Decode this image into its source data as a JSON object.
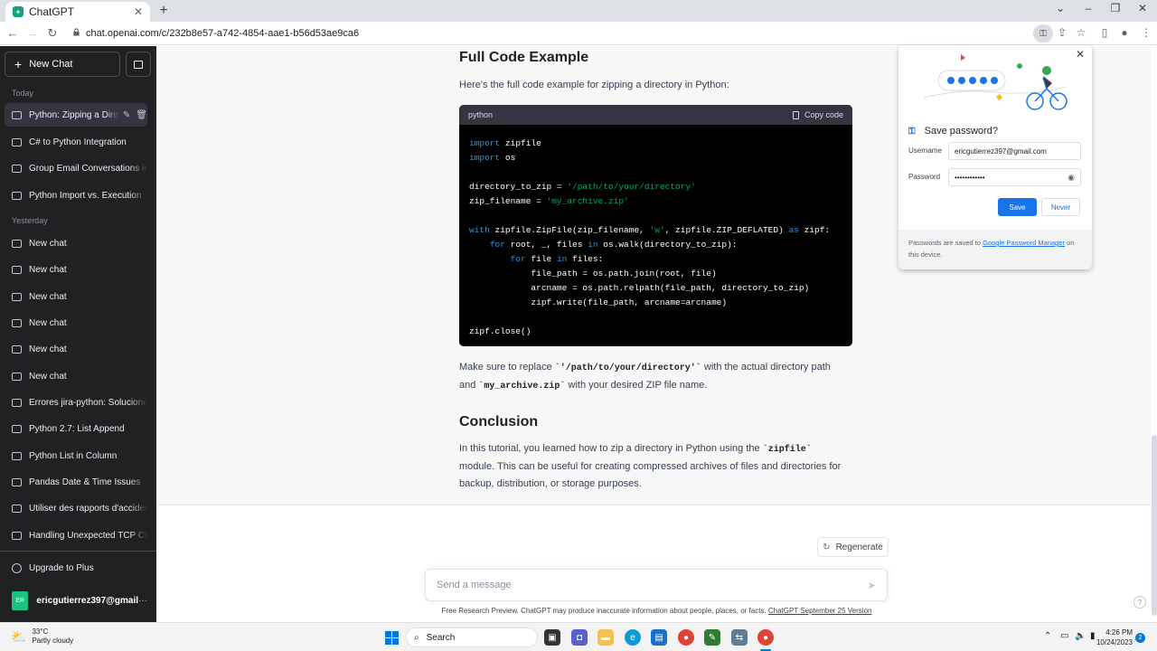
{
  "browser": {
    "tab_title": "ChatGPT",
    "url": "chat.openai.com/c/232b8e57-a742-4854-aae1-b56d53ae9ca6"
  },
  "sidebar": {
    "new_chat_label": "New Chat",
    "today_label": "Today",
    "today_items": [
      {
        "label": "Python: Zipping a Dire"
      },
      {
        "label": "C# to Python Integration"
      },
      {
        "label": "Group Email Conversations in"
      },
      {
        "label": "Python Import vs. Execution"
      }
    ],
    "yesterday_label": "Yesterday",
    "yesterday_items": [
      {
        "label": "New chat"
      },
      {
        "label": "New chat"
      },
      {
        "label": "New chat"
      },
      {
        "label": "New chat"
      },
      {
        "label": "New chat"
      },
      {
        "label": "New chat"
      },
      {
        "label": "Errores jira-python: Soluciones"
      },
      {
        "label": "Python 2.7: List Append"
      },
      {
        "label": "Python List in Column"
      },
      {
        "label": "Pandas Date & Time Issues"
      },
      {
        "label": "Utiliser des rapports d'accidents"
      },
      {
        "label": "Handling Unexpected TCP Close"
      }
    ],
    "upgrade_label": "Upgrade to Plus",
    "account": {
      "initials": "ER",
      "name": "ericgutierrez397@gmail"
    }
  },
  "main": {
    "heading_code": "Full Code Example",
    "intro": "Here's the full code example for zipping a directory in Python:",
    "code": {
      "language": "python",
      "copy_label": "Copy code"
    },
    "replace_note": {
      "prefix": "Make sure to replace ",
      "path": "`'/path/to/your/directory'`",
      "middle": " with the actual directory path and ",
      "file": "`my_archive.zip`",
      "suffix": " with your desired ZIP file name."
    },
    "heading_conclusion": "Conclusion",
    "conclusion": {
      "prefix": "In this tutorial, you learned how to zip a directory in Python using the ",
      "module": "`zipfile`",
      "suffix": " module. This can be useful for creating compressed archives of files and directories for backup, distribution, or storage purposes."
    },
    "regenerate_label": "Regenerate",
    "message_placeholder": "Send a message",
    "footer_text": "Free Research Preview. ChatGPT may produce inaccurate information about people, places, or facts. ",
    "footer_link": "ChatGPT September 25 Version",
    "help_label": "?"
  },
  "password_popup": {
    "title": "Save password?",
    "username_label": "Username",
    "username_value": "ericgutierrez397@gmail.com",
    "password_label": "Password",
    "password_value": "••••••••••••",
    "save_label": "Save",
    "never_label": "Never",
    "note_prefix": "Passwords are saved to ",
    "note_link": "Google Password Manager",
    "note_suffix": " on this device."
  },
  "taskbar": {
    "weather_temp": "33°C",
    "weather_desc": "Partly cloudy",
    "search_label": "Search",
    "time": "4:26 PM",
    "date": "10/24/2023",
    "notification_count": "2"
  },
  "colors": {
    "sidebar_bg": "#202123",
    "code_bg": "#000000",
    "keyword": "#2e95d3",
    "string": "#00a67d",
    "chrome_blue": "#1a73e8"
  }
}
